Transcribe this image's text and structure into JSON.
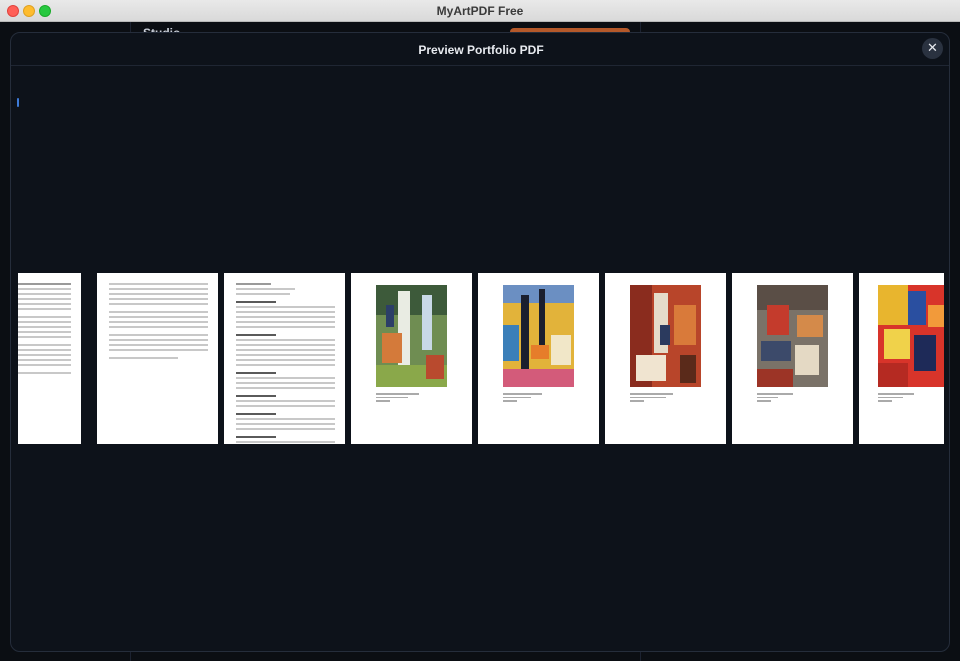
{
  "window": {
    "title": "MyArtPDF Free"
  },
  "background": {
    "heading": "Studio"
  },
  "modal": {
    "title": "Preview Portfolio PDF",
    "close_label": "✕"
  },
  "pages": [
    {
      "kind": "text",
      "number": ""
    },
    {
      "kind": "text",
      "number": ""
    },
    {
      "kind": "text",
      "number": ""
    },
    {
      "kind": "artwork",
      "number": "",
      "art": "green-white-abstract"
    },
    {
      "kind": "artwork",
      "number": "",
      "art": "yellow-blue-abstract"
    },
    {
      "kind": "artwork",
      "number": "",
      "art": "red-orange-abstract"
    },
    {
      "kind": "artwork",
      "number": "",
      "art": "grey-red-abstract"
    },
    {
      "kind": "artwork",
      "number": "",
      "art": "red-yellow-blue-abstract"
    }
  ],
  "colors": {
    "accent": "#3d7bd9",
    "background": "#0d121a",
    "orange_button": "#b5592a"
  }
}
